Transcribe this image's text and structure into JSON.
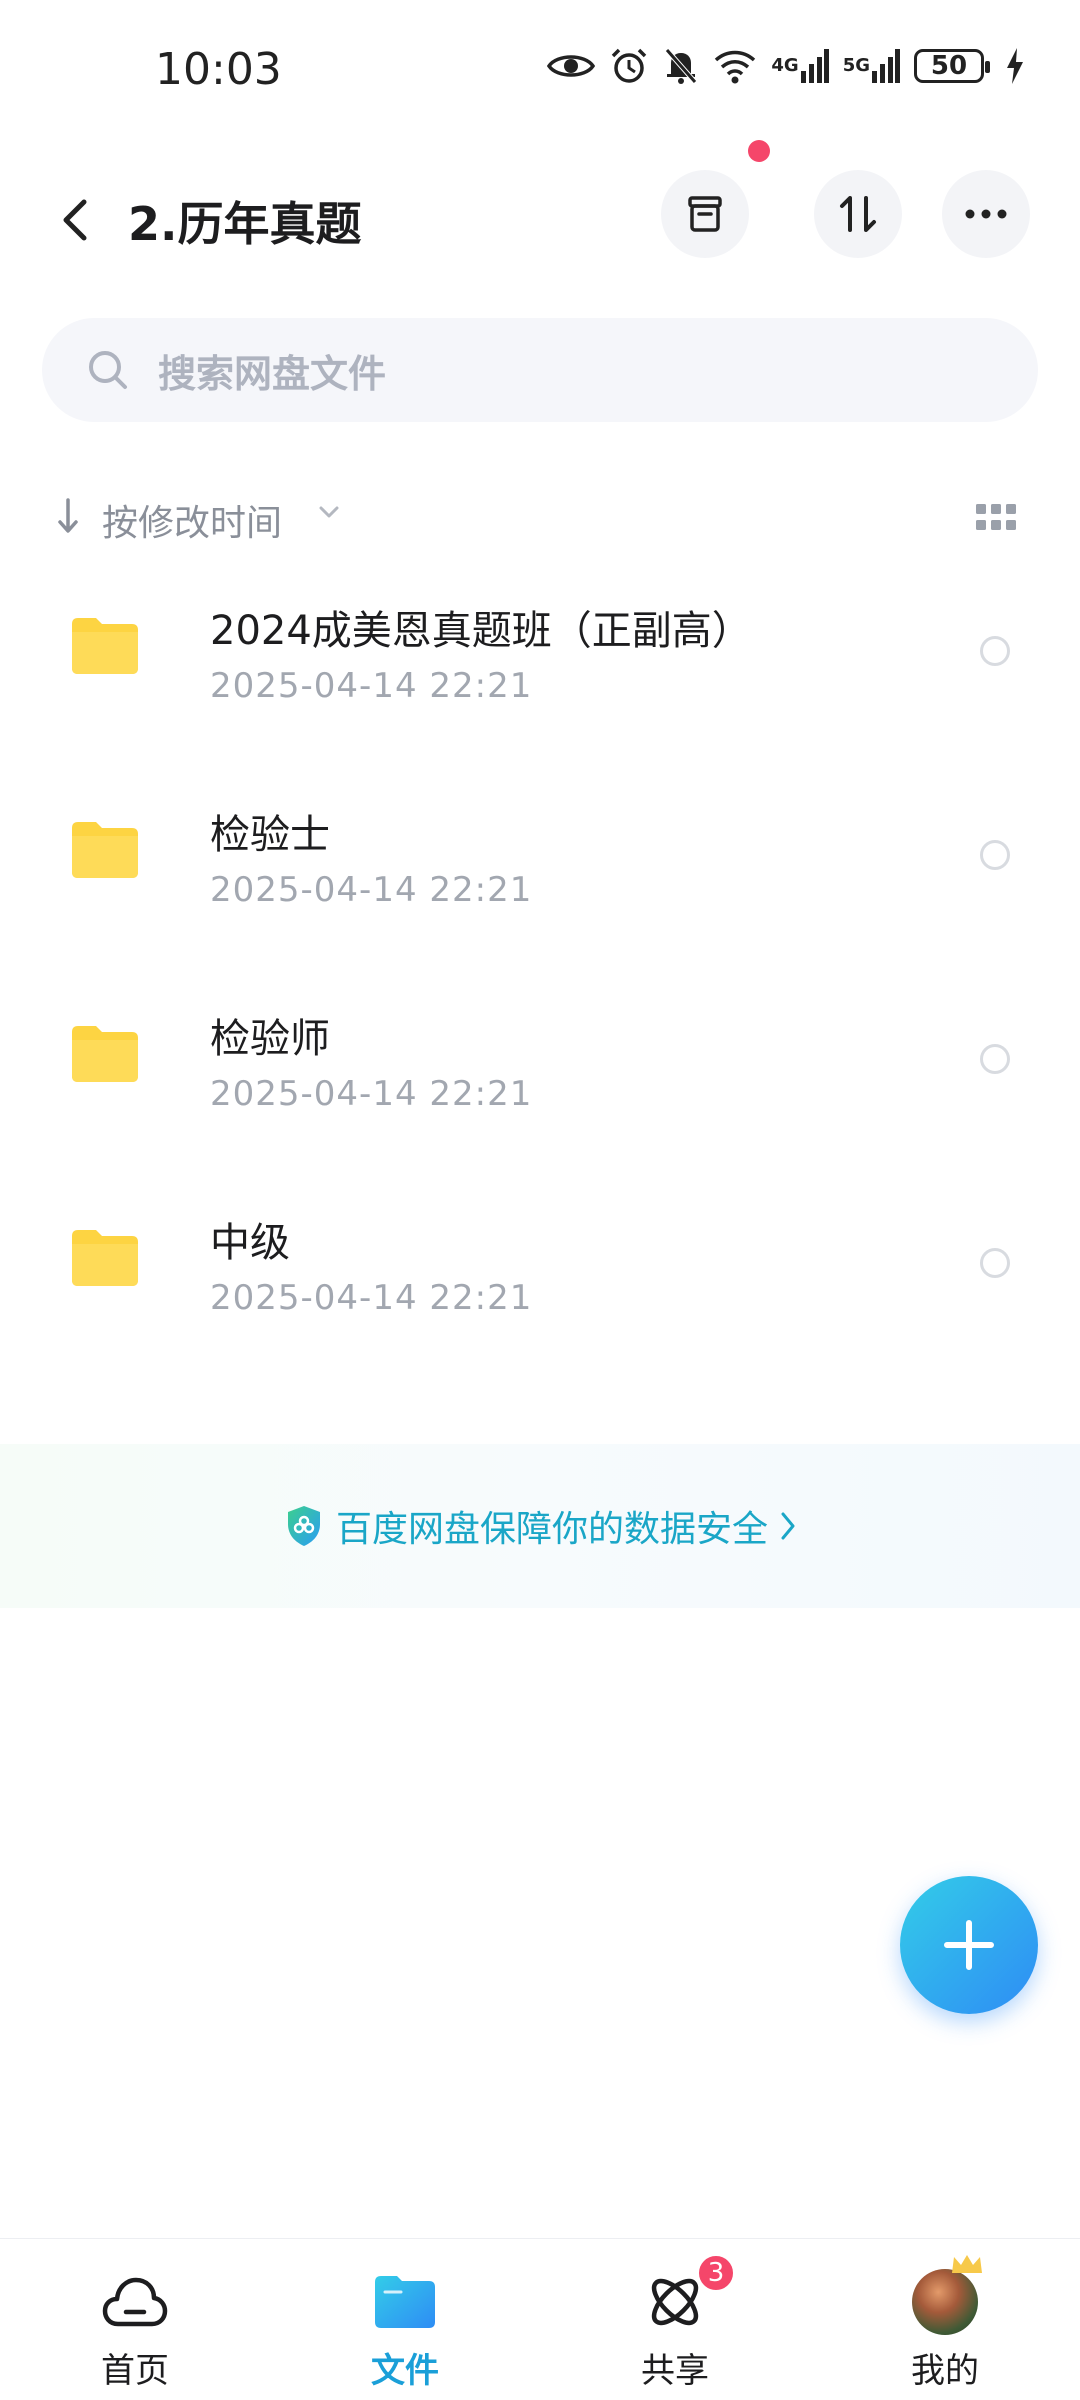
{
  "status_bar": {
    "time": "10:03",
    "net_4g": "4G",
    "net_5g": "5G",
    "battery": "50"
  },
  "header": {
    "title": "2.历年真题"
  },
  "search": {
    "placeholder": "搜索网盘文件"
  },
  "sort": {
    "label": "按修改时间"
  },
  "files": [
    {
      "name": "2024成美恩真题班（正副高）",
      "date": "2025-04-14  22:21"
    },
    {
      "name": "检验士",
      "date": "2025-04-14  22:21"
    },
    {
      "name": "检验师",
      "date": "2025-04-14  22:21"
    },
    {
      "name": "中级",
      "date": "2025-04-14  22:21"
    }
  ],
  "banner": {
    "text": "百度网盘保障你的数据安全"
  },
  "nav": {
    "items": [
      {
        "label": "首页"
      },
      {
        "label": "文件"
      },
      {
        "label": "共享"
      },
      {
        "label": "我的"
      }
    ],
    "share_badge": "3"
  },
  "colors": {
    "accent": "#1a9fd8",
    "folder": "#fdd442",
    "badge": "#f5466a",
    "banner_text": "#1aa6c7"
  }
}
